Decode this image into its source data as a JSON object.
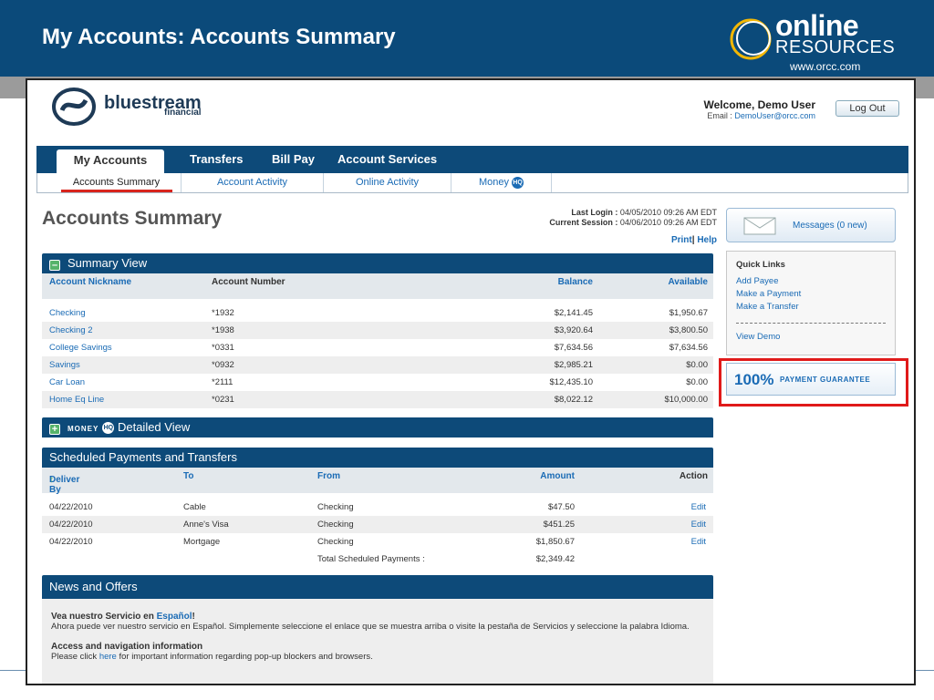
{
  "slide": {
    "title": "My Accounts: Accounts Summary",
    "logo_online": "online",
    "logo_resources": "RESOURCES",
    "logo_url": "www.orcc.com"
  },
  "bank": {
    "name": "bluestream",
    "sub": "financial"
  },
  "user": {
    "welcome": "Welcome, Demo User",
    "email_label": "Email :",
    "email": "DemoUser@orcc.com",
    "logout": "Log Out"
  },
  "nav": {
    "tabs": [
      "My Accounts",
      "Transfers",
      "Bill Pay",
      "Account Services"
    ],
    "subtabs": [
      "Accounts Summary",
      "Account Activity",
      "Online Activity",
      "Money"
    ],
    "hq": "HQ"
  },
  "page": {
    "title": "Accounts Summary",
    "last_login_label": "Last Login :",
    "last_login": "04/05/2010 09:26 AM EDT",
    "session_label": "Current Session :",
    "session": "04/06/2010 09:26 AM EDT",
    "print": "Print",
    "sep": "|",
    "help": "Help"
  },
  "summary": {
    "title": "Summary View",
    "toggle": "–",
    "headers": [
      "Account Nickname",
      "Account Number",
      "Balance",
      "Available"
    ],
    "rows": [
      [
        "Checking",
        "*1932",
        "$2,141.45",
        "$1,950.67"
      ],
      [
        "Checking 2",
        "*1938",
        "$3,920.64",
        "$3,800.50"
      ],
      [
        "College Savings",
        "*0331",
        "$7,634.56",
        "$7,634.56"
      ],
      [
        "Savings",
        "*0932",
        "$2,985.21",
        "$0.00"
      ],
      [
        "Car Loan",
        "*2111",
        "$12,435.10",
        "$0.00"
      ],
      [
        "Home Eq Line",
        "*0231",
        "$8,022.12",
        "$10,000.00"
      ]
    ]
  },
  "moneyhq": {
    "toggle": "+",
    "money": "MONEY",
    "title": "Detailed View"
  },
  "scheduled": {
    "title": "Scheduled Payments and Transfers",
    "headers": [
      "Deliver By",
      "To",
      "From",
      "Amount",
      "Action"
    ],
    "sort_arrow": "↑",
    "rows": [
      [
        "04/22/2010",
        "Cable",
        "Checking",
        "$47.50",
        "Edit"
      ],
      [
        "04/22/2010",
        "Anne's Visa",
        "Checking",
        "$451.25",
        "Edit"
      ],
      [
        "04/22/2010",
        "Mortgage",
        "Checking",
        "$1,850.67",
        "Edit"
      ]
    ],
    "total_label": "Total Scheduled Payments :",
    "total": "$2,349.42"
  },
  "news": {
    "title": "News and Offers",
    "item1_title": "Vea nuestro Servicio en ",
    "item1_link": "Español",
    "item1_bang": "!",
    "item1_body": "Ahora puede ver nuestro servicio en Español. Simplemente seleccione el enlace que se muestra arriba o visite la pestaña de Servicios y seleccione la palabra Idioma.",
    "item2_title": "Access and navigation information",
    "item2_pre": "Please click ",
    "item2_link": "here",
    "item2_post": " for important information regarding pop-up blockers and browsers."
  },
  "sidebar": {
    "messages": "Messages (0 new)",
    "quick_title": "Quick Links",
    "quick_links": [
      "Add Payee",
      "Make a Payment",
      "Make a Transfer"
    ],
    "view_demo": "View Demo",
    "guarantee_pct": "100%",
    "guarantee_text": "PAYMENT GUARANTEE"
  },
  "colors": {
    "navy": "#0d4a79",
    "slide_blue": "#0b4a7a",
    "link": "#1a6bb5",
    "highlight": "#e01a1a"
  }
}
